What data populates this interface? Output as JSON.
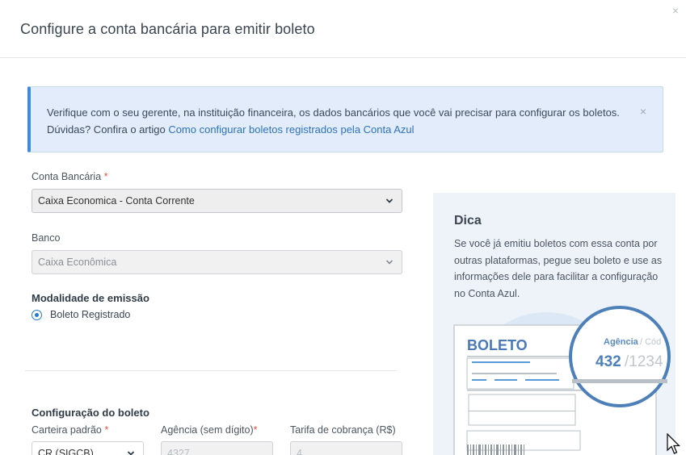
{
  "header": {
    "title": "Configure a conta bancária para emitir boleto"
  },
  "alert": {
    "text": "Verifique com o seu gerente, na instituição financeira, os dados bancários que você vai precisar para configurar os boletos. Dúvidas? Confira o artigo ",
    "link": "Como configurar boletos registrados pela Conta Azul",
    "close": "×"
  },
  "close_modal": "×",
  "form": {
    "conta_label": "Conta Bancária",
    "conta_value": "Caixa Economica - Conta Corrente",
    "banco_label": "Banco",
    "banco_value": "Caixa Econômica",
    "modalidade_title": "Modalidade de emissão",
    "modalidade_option": "Boleto Registrado",
    "config_title": "Configuração do boleto",
    "carteira_label": "Carteira padrão",
    "carteira_value": "CR (SIGCB)",
    "agencia_label": "Agência (sem dígito)",
    "agencia_value": "4327",
    "tarifa_label": "Tarifa de cobrança (R$)",
    "tarifa_value": "4,",
    "required_mark": "*"
  },
  "tip": {
    "title": "Dica",
    "text": "Se você já emitiu boletos com essa conta por outras plataformas, pegue seu boleto e use as informações dele para facilitar a configuração no Conta Azul.",
    "boleto_label": "BOLETO",
    "zoom_label": "Agência",
    "zoom_label2": "/ Cód",
    "zoom_value": "432",
    "zoom_value2": "/1234"
  },
  "colors": {
    "accent": "#1f7ad1",
    "alert_bg": "#e2ecfb",
    "required": "#e0533b"
  }
}
